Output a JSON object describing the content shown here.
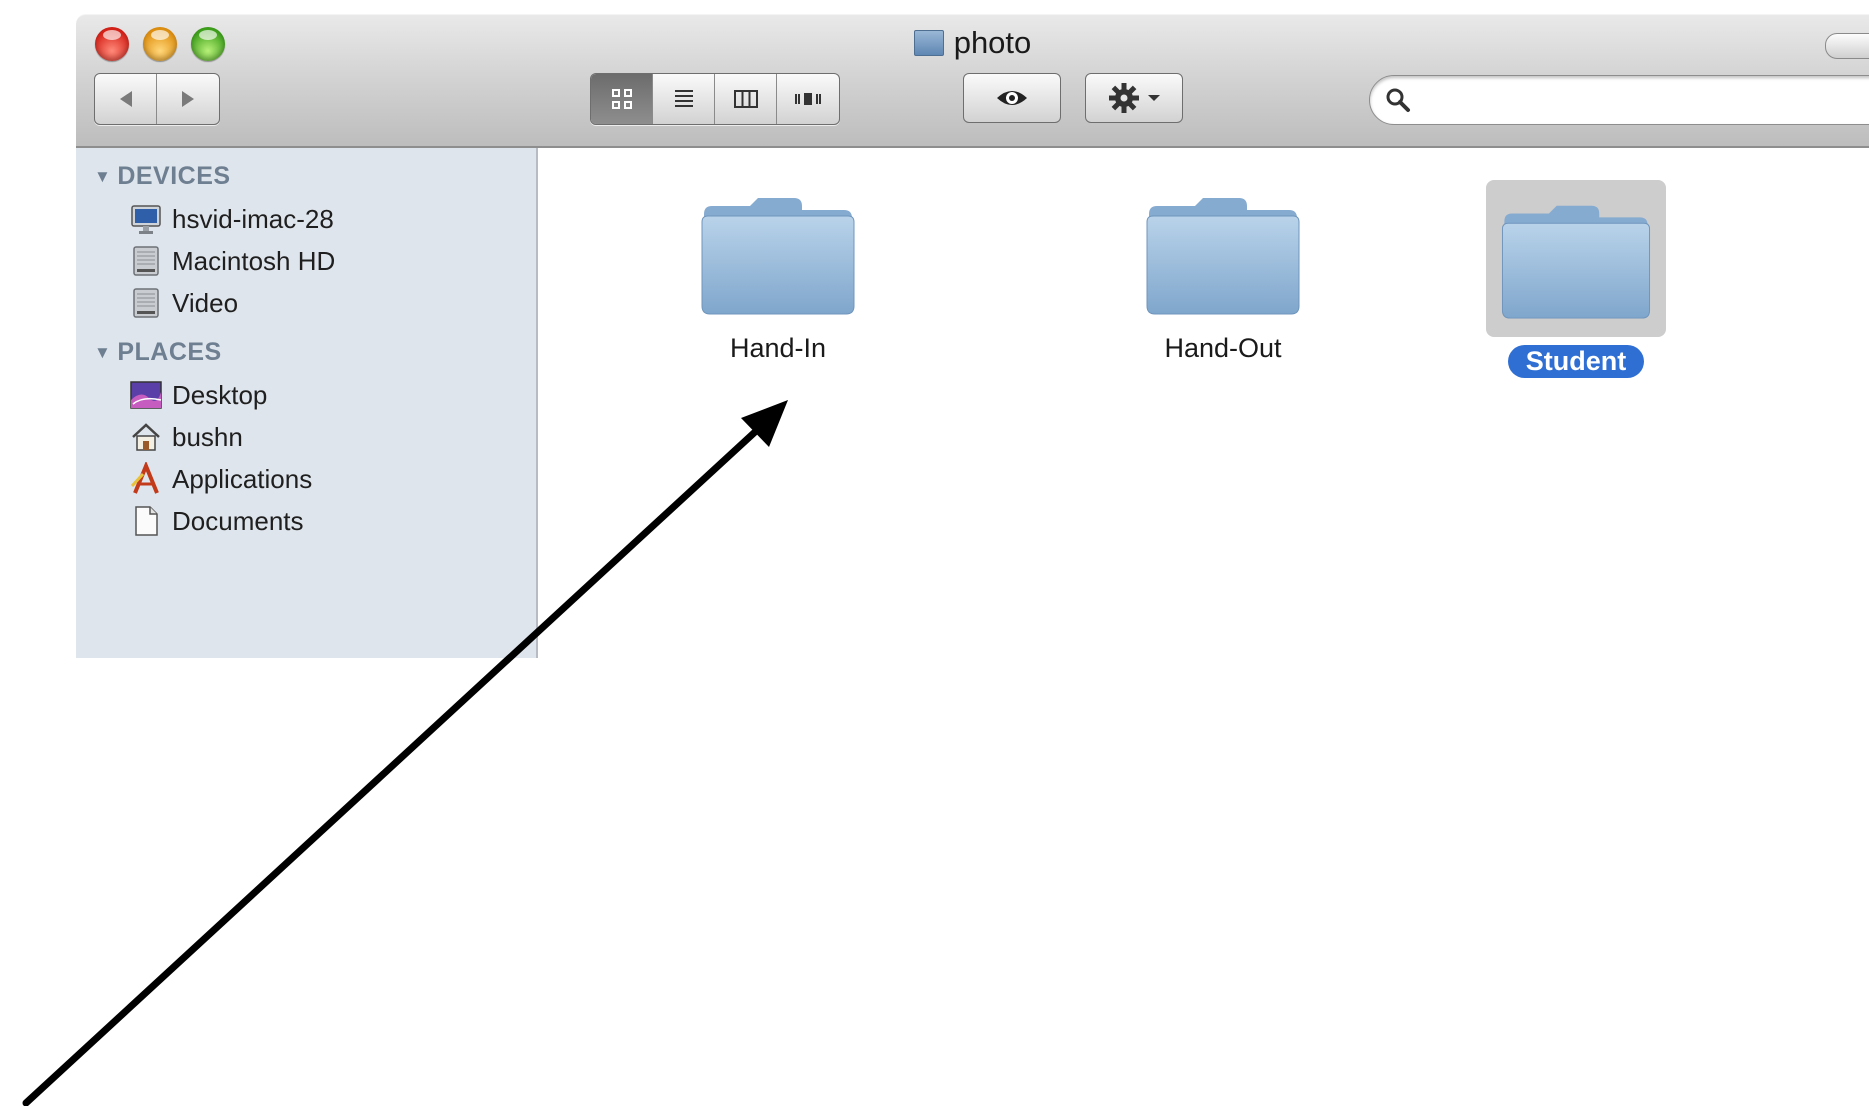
{
  "window": {
    "title": "photo"
  },
  "toolbar": {
    "nav": [
      "back-arrow-icon",
      "forward-arrow-icon"
    ],
    "views": [
      "icon-view",
      "list-view",
      "column-view",
      "coverflow-view"
    ],
    "active_view": "icon-view",
    "quick_look": "eye-icon",
    "action": "gear-icon",
    "search": {
      "value": "",
      "placeholder": ""
    }
  },
  "sidebar": {
    "sections": [
      {
        "title": "DEVICES",
        "items": [
          {
            "label": "hsvid-imac-28",
            "icon": "imac-icon"
          },
          {
            "label": "Macintosh HD",
            "icon": "hard-drive-icon"
          },
          {
            "label": "Video",
            "icon": "hard-drive-icon"
          }
        ]
      },
      {
        "title": "PLACES",
        "items": [
          {
            "label": "Desktop",
            "icon": "desktop-icon"
          },
          {
            "label": "bushn",
            "icon": "home-icon"
          },
          {
            "label": "Applications",
            "icon": "applications-icon"
          },
          {
            "label": "Documents",
            "icon": "document-icon"
          }
        ]
      }
    ]
  },
  "content": {
    "items": [
      {
        "label": "Hand-In",
        "selected": false
      },
      {
        "label": "Hand-Out",
        "selected": false
      },
      {
        "label": "Student",
        "selected": true
      }
    ]
  },
  "colors": {
    "sidebar_bg": "#dfe5ec",
    "section_header": "#6f7f92",
    "selection": "#2f6fd3",
    "folder": "#8fb6da"
  }
}
